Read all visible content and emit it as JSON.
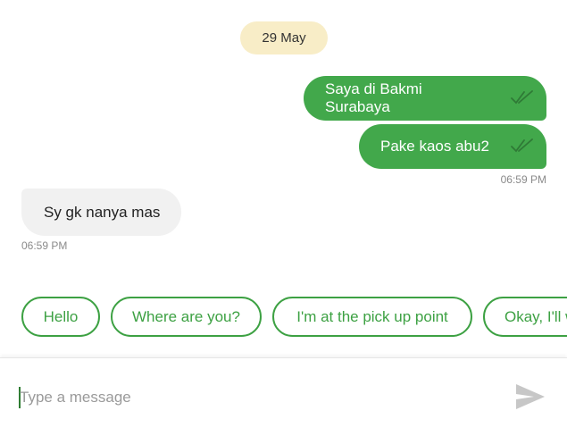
{
  "chat": {
    "date_label": "29 May",
    "outgoing": [
      {
        "text": "Saya di Bakmi Surabaya"
      },
      {
        "text": "Pake kaos abu2"
      }
    ],
    "outgoing_time": "06:59 PM",
    "incoming": [
      {
        "text": "Sy gk nanya mas"
      }
    ],
    "incoming_time": "06:59 PM"
  },
  "quick_replies": [
    "Hello",
    "Where are you?",
    "I'm at the pick up point",
    "Okay, I'll w"
  ],
  "composer": {
    "placeholder": "Type a message"
  },
  "icons": {
    "read_ticks": "double-check-icon",
    "send": "send-icon"
  },
  "colors": {
    "outgoing_bubble": "#42a84b",
    "incoming_bubble": "#f1f1f1",
    "date_chip": "#f8edc7",
    "accent": "#3da143"
  }
}
